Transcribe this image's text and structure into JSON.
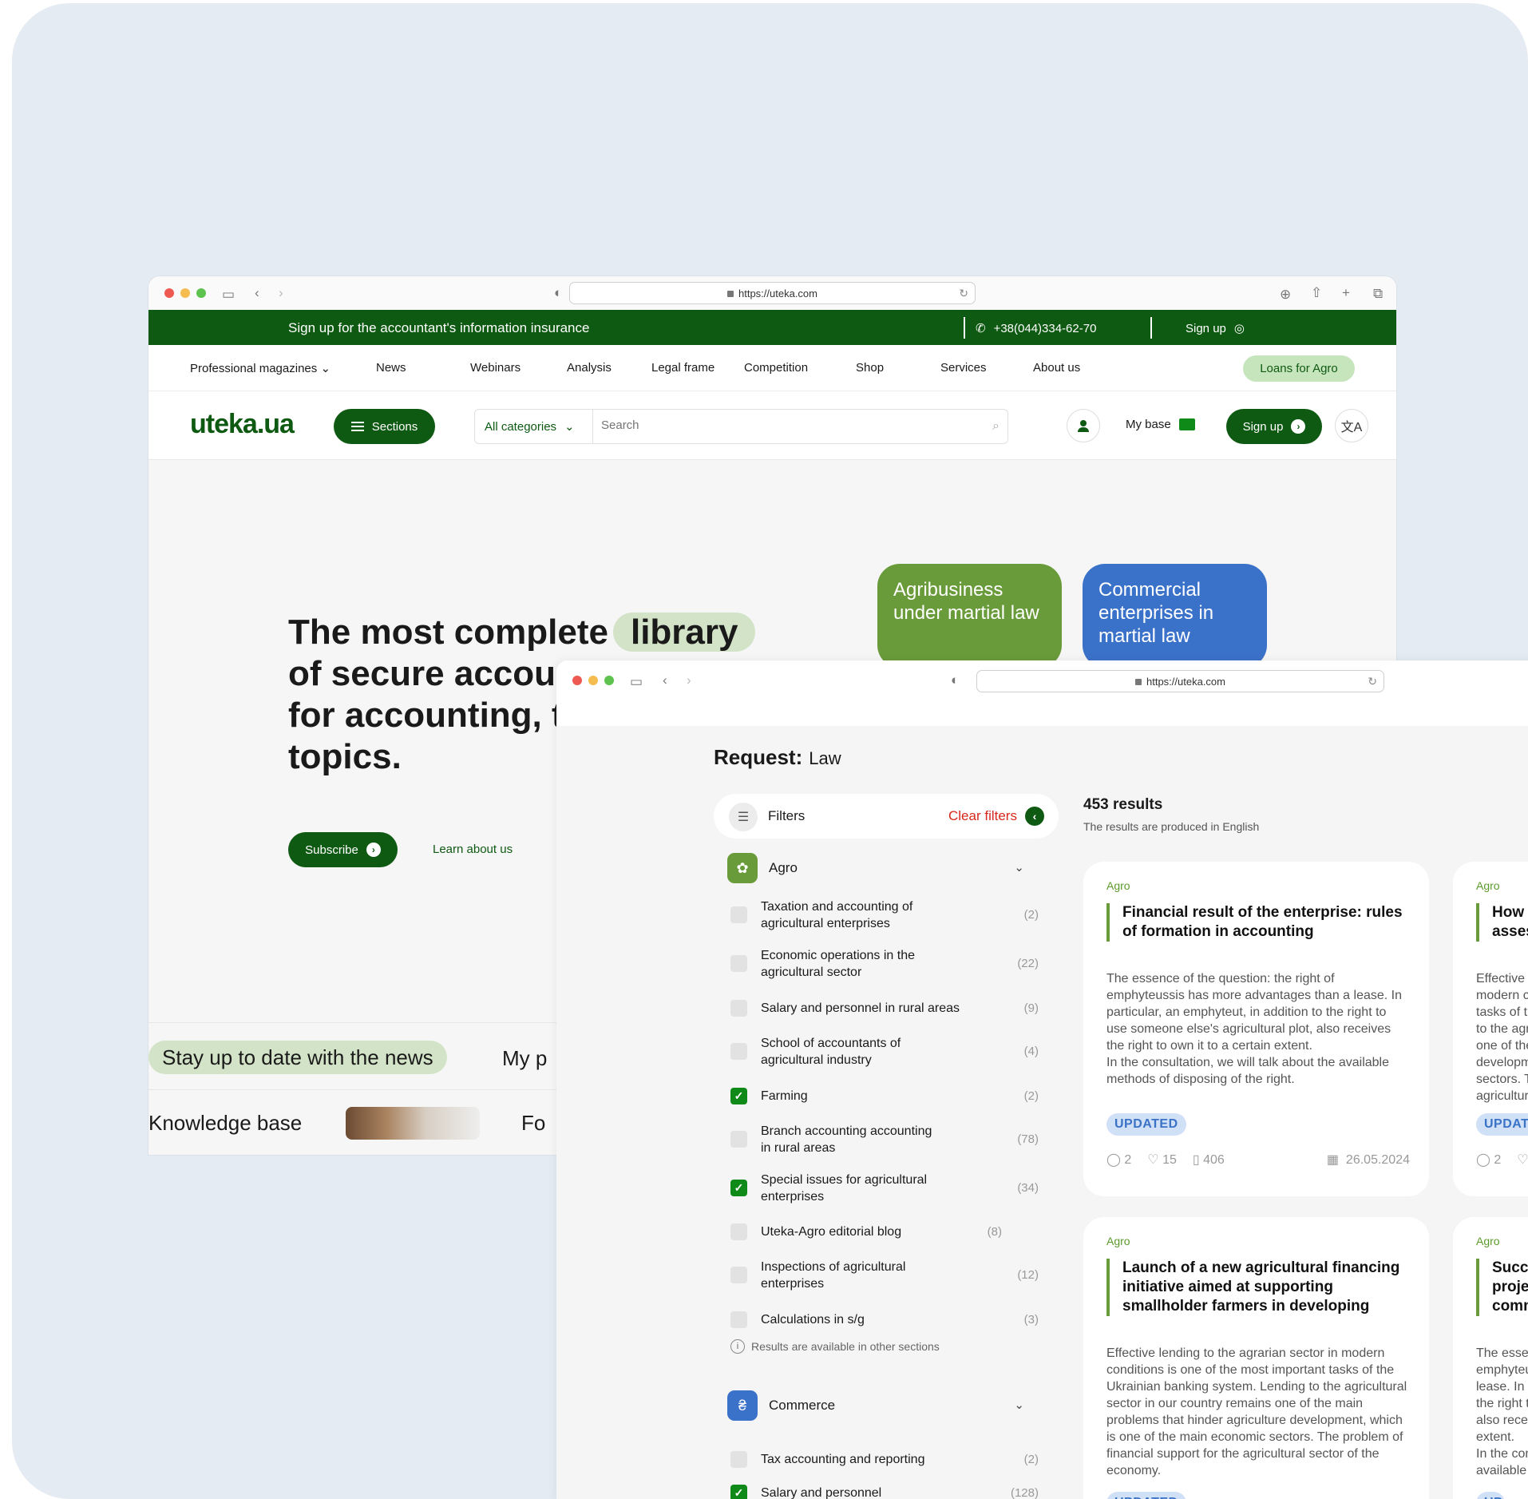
{
  "window1": {
    "url": "https://uteka.com",
    "topbar": {
      "promo": "Sign up for the accountant's information insurance",
      "phone": "+38(044)334-62-70",
      "signup": "Sign up"
    },
    "nav": {
      "items": [
        "Professional magazines",
        "News",
        "Webinars",
        "Analysis",
        "Legal frame",
        "Competition",
        "Shop",
        "Services",
        "About us"
      ],
      "loans": "Loans for Agro"
    },
    "header": {
      "logo": "uteka.ua",
      "sections": "Sections",
      "category": "All categories",
      "search_placeholder": "Search",
      "my_base": "My base",
      "sign_up": "Sign up"
    },
    "hero": {
      "line1": "The most complete",
      "highlight": "library",
      "line2": "of secure accou",
      "line3": "for accounting, t",
      "line4": "topics.",
      "subscribe": "Subscribe",
      "learn": "Learn about us"
    },
    "cards": [
      {
        "title": "Agribusiness under martial law",
        "color": "#6a9b3a"
      },
      {
        "title": "Commercial enterprises in martial law",
        "color": "#3b72c9"
      }
    ],
    "ticker": {
      "stay": "Stay up to date with the news",
      "myp": "My p",
      "kb": "Knowledge base",
      "fo": "Fo"
    }
  },
  "window2": {
    "url": "https://uteka.com",
    "request_label": "Request:",
    "request_value": "Law",
    "filters": {
      "title": "Filters",
      "clear": "Clear filters"
    },
    "agro": {
      "title": "Agro",
      "items": [
        {
          "label": "Taxation and accounting of agricultural enterprises",
          "count": "(2)",
          "checked": false
        },
        {
          "label": "Economic operations in the agricultural sector",
          "count": "(22)",
          "checked": false
        },
        {
          "label": "Salary and personnel in rural areas",
          "count": "(9)",
          "checked": false
        },
        {
          "label": "School of accountants of agricultural industry",
          "count": "(4)",
          "checked": false
        },
        {
          "label": "Farming",
          "count": "(2)",
          "checked": true
        },
        {
          "label": "Branch accounting accounting in rural areas",
          "count": "(78)",
          "checked": false
        },
        {
          "label": "Special issues for agricultural enterprises",
          "count": "(34)",
          "checked": true
        },
        {
          "label": "Uteka-Agro editorial blog",
          "count": "(8)",
          "checked": false
        },
        {
          "label": "Inspections of agricultural enterprises",
          "count": "(12)",
          "checked": false
        },
        {
          "label": "Calculations in s/g",
          "count": "(3)",
          "checked": false
        }
      ],
      "note": "Results are available in other sections"
    },
    "commerce": {
      "title": "Commerce",
      "items": [
        {
          "label": "Tax accounting and reporting",
          "count": "(2)",
          "checked": false
        },
        {
          "label": "Salary and personnel",
          "count": "(128)",
          "checked": true
        }
      ]
    },
    "results": {
      "count": "453 results",
      "note": "The results are produced in English"
    },
    "articles": [
      {
        "tag": "Agro",
        "title": "Financial result of the enterprise: rules of formation in accounting",
        "body": "The essence of the question: the right of emphyteussis has more advantages than a lease. In particular, an emphyteut, in addition to the right to use someone else's agricultural plot, also receives the right to own it to a certain extent.\nIn the consultation, we will talk about the available methods of disposing of the right.",
        "badge": "UPDATED",
        "comments": "2",
        "likes": "15",
        "views": "406",
        "date": "26.05.2024"
      },
      {
        "tag": "Agro",
        "title": "How d\nassess",
        "body": "Effective le\nmodern co\ntasks of th\nto the agri\none of the\ndevelopme\nsectors. Th\nagricultura",
        "badge": "UPDATED",
        "comments": "2"
      },
      {
        "tag": "Agro",
        "title": "Launch of a new agricultural financing initiative aimed at supporting smallholder farmers in developing",
        "body": "Effective lending to the agrarian sector in modern conditions is one of the most important tasks of the Ukrainian banking system. Lending to the agricultural sector in our country remains one of the main problems that hinder agriculture development, which is one of the main economic sectors. The problem of financial support for the agricultural sector of the economy.",
        "badge": "UPDATED"
      },
      {
        "tag": "Agro",
        "title": "Succes\nprojec\ncommu",
        "body": "The essen\nemphyteus\nlease. In pa\nthe right to\nalso receiv\nextent.\nIn the cons\navailable"
      }
    ]
  }
}
